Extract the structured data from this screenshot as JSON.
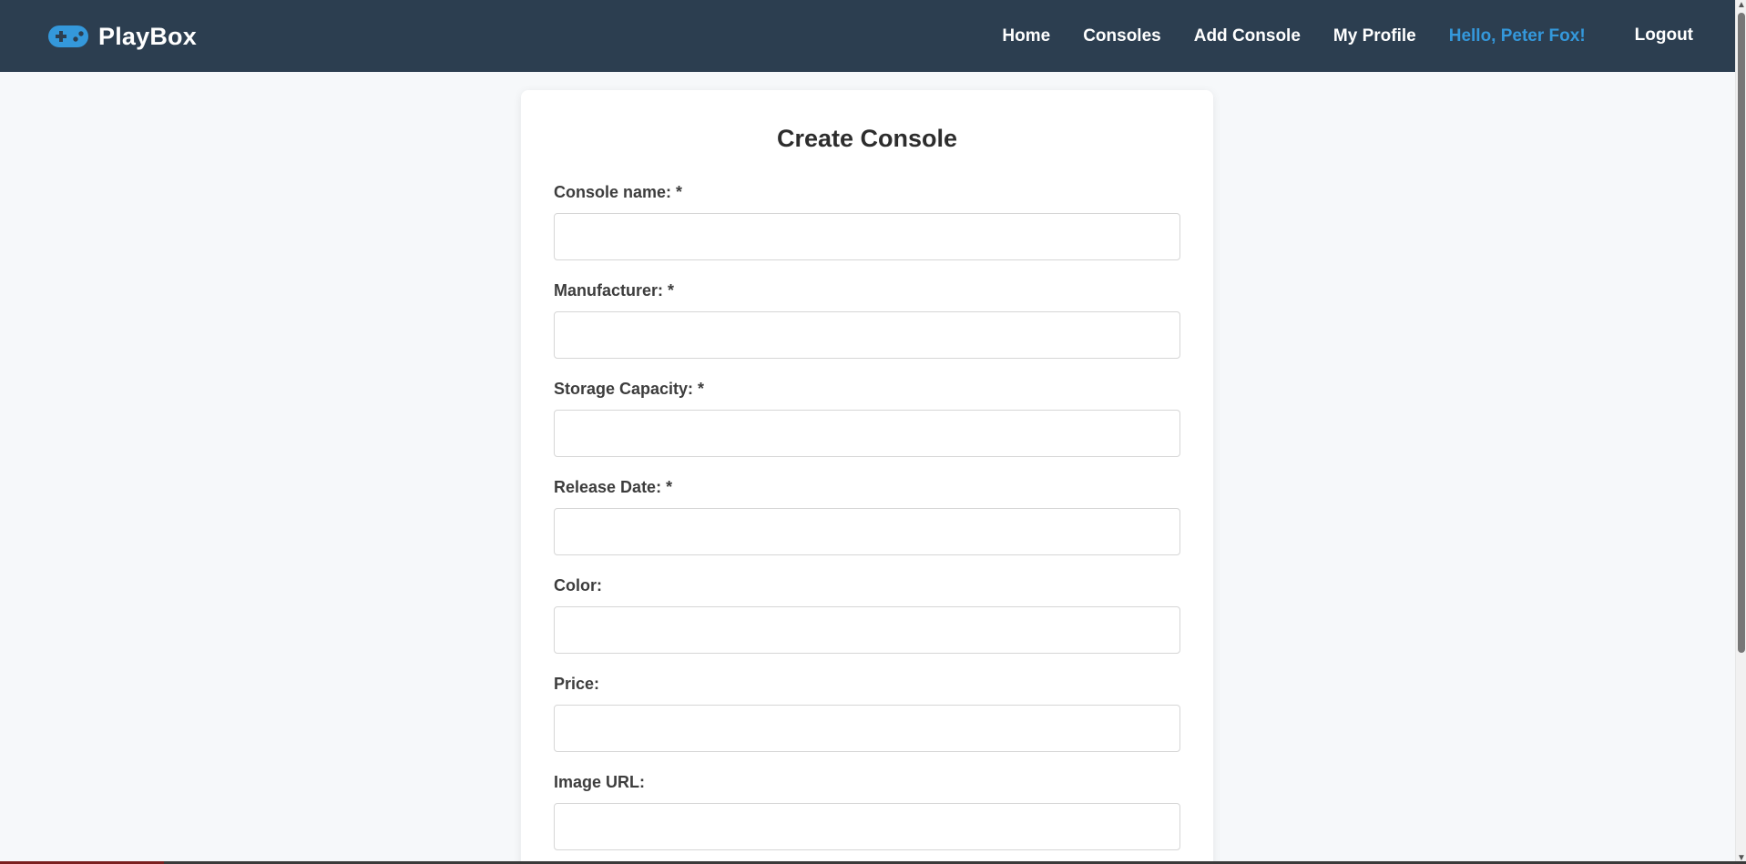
{
  "header": {
    "brand": "PlayBox",
    "brand_icon": "gamepad-icon",
    "nav": {
      "home": "Home",
      "consoles": "Consoles",
      "add_console": "Add Console",
      "my_profile": "My Profile",
      "greeting": "Hello, Peter Fox!",
      "logout": "Logout"
    },
    "colors": {
      "background": "#2c3e50",
      "greeting": "#3498db",
      "brand_icon": "#3498db"
    }
  },
  "form": {
    "title": "Create Console",
    "fields": [
      {
        "label": "Console name: *",
        "value": "",
        "placeholder": ""
      },
      {
        "label": "Manufacturer: *",
        "value": "",
        "placeholder": ""
      },
      {
        "label": "Storage Capacity: *",
        "value": "",
        "placeholder": ""
      },
      {
        "label": "Release Date: *",
        "value": "",
        "placeholder": ""
      },
      {
        "label": "Color:",
        "value": "",
        "placeholder": ""
      },
      {
        "label": "Price:",
        "value": "",
        "placeholder": ""
      },
      {
        "label": "Image URL:",
        "value": "",
        "placeholder": ""
      }
    ]
  }
}
